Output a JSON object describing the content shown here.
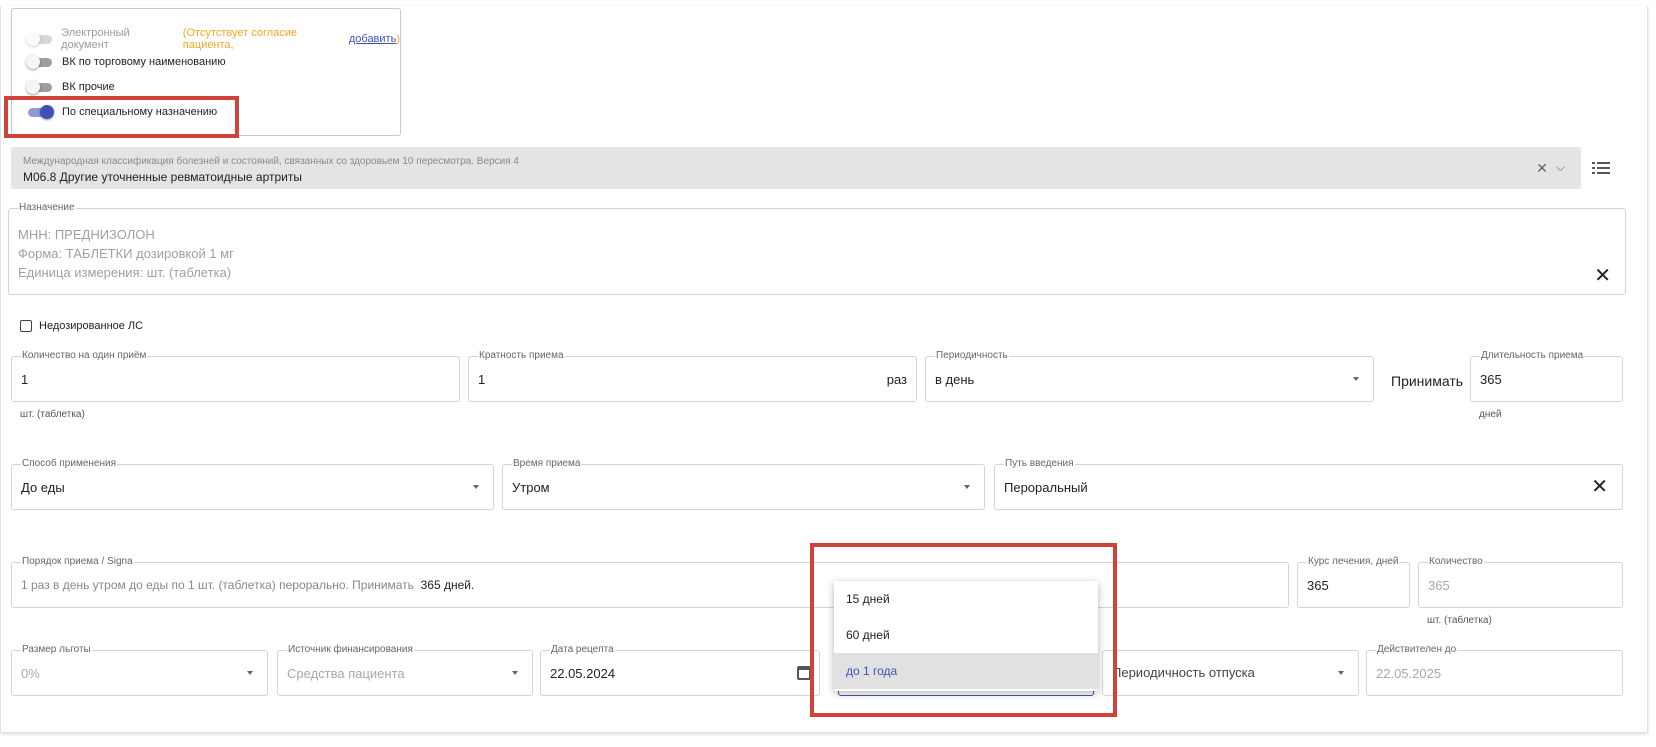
{
  "toggles": [
    {
      "label": "Электронный документ",
      "state": "disabled",
      "warning": "(Отсутствует согласие пациента,",
      "link": "добавить",
      "suffix": ")"
    },
    {
      "label": "ВК по торговому наименованию",
      "state": "off"
    },
    {
      "label": "ВК прочие",
      "state": "off"
    },
    {
      "label": "По специальному назначению",
      "state": "on"
    }
  ],
  "icd": {
    "label": "Международная классификация болезней и состояний, связанных со здоровьем 10 пересмотра. Версия 4",
    "value": "M06.8 Другие уточненные ревматоидные артриты"
  },
  "naznachenie": {
    "label": "Назначение",
    "lines": [
      "МНН: ПРЕДНИЗОЛОН",
      "Форма: ТАБЛЕТКИ дозировкой 1 мг",
      "Единица измерения: шт. (таблетка)"
    ]
  },
  "undosed": {
    "label": "Недозированное ЛС"
  },
  "dose": {
    "label": "Количество на один приём",
    "value": "1",
    "helper": "шт. (таблетка)"
  },
  "multiplicity": {
    "label": "Кратность приема",
    "value": "1",
    "suffix": "раз"
  },
  "periodicity": {
    "label": "Периодичность",
    "value": "в день"
  },
  "take_label": "Принимать",
  "duration": {
    "label": "Длительность приема",
    "value": "365",
    "helper": "дней"
  },
  "method": {
    "label": "Способ применения",
    "value": "До еды"
  },
  "time": {
    "label": "Время приема",
    "value": "Утром"
  },
  "route": {
    "label": "Путь введения",
    "value": "Пероральный"
  },
  "signa": {
    "label": "Порядок приема / Signa",
    "value": "1 раз в день утром до еды по 1 шт. (таблетка) перорально. Принимать",
    "value_bold": "365 дней."
  },
  "course": {
    "label": "Курс лечения, дней",
    "value": "365"
  },
  "quantity": {
    "label": "Количество",
    "value": "365",
    "helper": "шт. (таблетка)"
  },
  "benefit": {
    "label": "Размер льготы",
    "value": "0%"
  },
  "funding": {
    "label": "Источник финансирования",
    "value": "Средства пациента"
  },
  "recipe_date": {
    "label": "Дата рецепта",
    "value": "22.05.2024"
  },
  "release_period": {
    "value": "Периодичность отпуска"
  },
  "valid_until": {
    "label": "Действителен до",
    "value": "22.05.2025"
  },
  "validity_dropdown": {
    "options": [
      {
        "label": "15 дней",
        "selected": false
      },
      {
        "label": "60 дней",
        "selected": false
      },
      {
        "label": "до 1 года",
        "selected": true
      }
    ]
  },
  "colors": {
    "accent": "#3f51b5",
    "highlight": "#d0433a",
    "warning": "#f5a623"
  }
}
